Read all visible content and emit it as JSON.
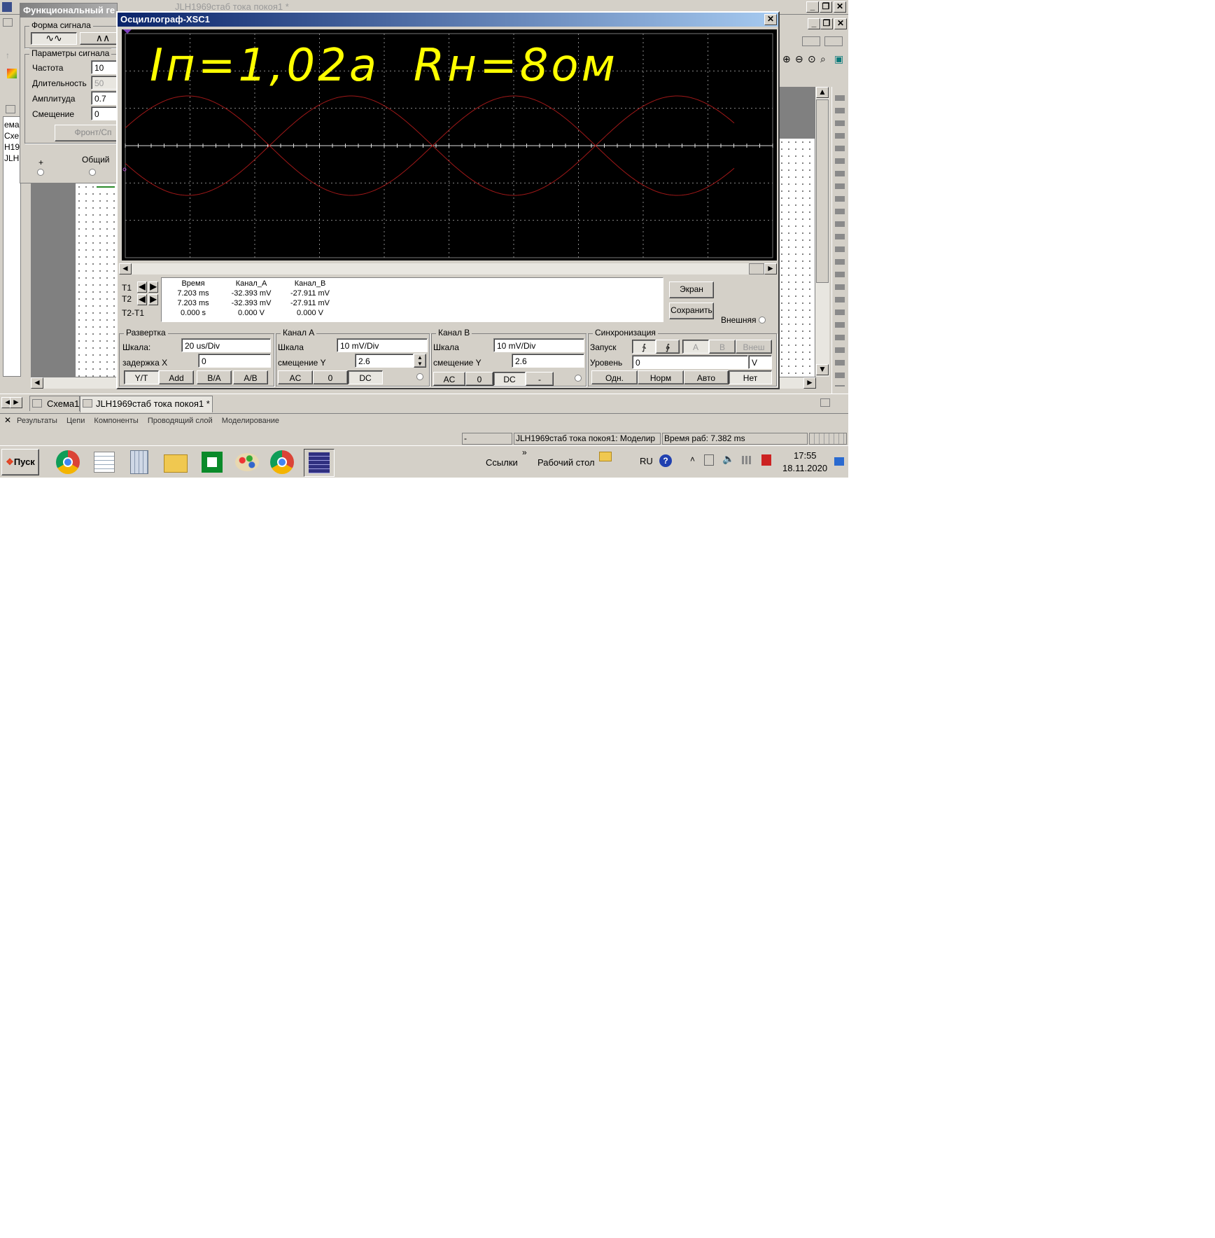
{
  "app": {
    "window_title": "JLH1969стаб тока покоя1 *",
    "tabs": [
      "Схема1",
      "JLH1969стаб тока покоя1 *"
    ],
    "results_tabs": [
      "Результаты",
      "Цепи",
      "Компоненты",
      "Проводящий слой",
      "Моделирование"
    ],
    "left_fragments": [
      "ема",
      "Схе",
      "Н19",
      "JLH"
    ],
    "status": {
      "left": "-",
      "middle": "JLH1969стаб тока покоя1: Моделир",
      "right": "Время раб: 7.382 ms"
    }
  },
  "fgen": {
    "title": "Функциональный ге",
    "waveform_group": "Форма сигнала",
    "params_group": "Параметры сигнала",
    "params": [
      {
        "label": "Частота",
        "value": "10",
        "disabled": false
      },
      {
        "label": "Длительность",
        "value": "50",
        "disabled": true
      },
      {
        "label": "Амплитуда",
        "value": "0.7",
        "disabled": false
      },
      {
        "label": "Смещение",
        "value": "0",
        "disabled": false
      }
    ],
    "front_button": "Фронт/Сп",
    "plus_label": "+",
    "common_label": "Общий"
  },
  "scope": {
    "title": "Осциллограф-XSC1",
    "annotation": "Iп=1,02а  Rн=8ом",
    "trace_color": "#a01818",
    "meas": {
      "headers": [
        "Время",
        "Канал_А",
        "Канал_В"
      ],
      "row_labels": [
        "T1",
        "T2",
        "T2-T1"
      ],
      "rows": [
        [
          "7.203 ms",
          "-32.393 mV",
          "-27.911 mV"
        ],
        [
          "7.203 ms",
          "-32.393 mV",
          "-27.911 mV"
        ],
        [
          "0.000 s",
          "0.000 V",
          "0.000 V"
        ]
      ]
    },
    "screen_button": "Экран",
    "save_button": "Сохранить",
    "external_label": "Внешняя",
    "timebase": {
      "title": "Развертка",
      "scale_label": "Шкала:",
      "scale": "20 us/Div",
      "delay_label": "задержка X",
      "delay": "0",
      "modes": [
        "Y/T",
        "Add",
        "B/A",
        "A/B"
      ]
    },
    "channel_a": {
      "title": "Канал А",
      "scale_label": "Шкала",
      "scale": "10 mV/Div",
      "offset_label": "смещение Y",
      "offset": "2.6",
      "coupling": [
        "AC",
        "0",
        "DC"
      ]
    },
    "channel_b": {
      "title": "Канал В",
      "scale_label": "Шкала",
      "scale": "10 mV/Div",
      "offset_label": "смещение Y",
      "offset": "2.6",
      "coupling": [
        "AC",
        "0",
        "DC",
        "-"
      ]
    },
    "trigger": {
      "title": "Синхронизация",
      "start_label": "Запуск",
      "edges": [
        "∱",
        "∲"
      ],
      "sources": [
        "A",
        "B",
        "Внеш"
      ],
      "level_label": "Уровень",
      "level": "0",
      "level_unit": "V",
      "modes": [
        "Одн.",
        "Норм",
        "Авто",
        "Нет"
      ]
    }
  },
  "taskbar": {
    "start": "Пуск",
    "links": "Ссылки",
    "desktop": "Рабочий стол",
    "lang": "RU",
    "time": "17:55",
    "date": "18.11.2020",
    "icons": [
      "chrome-icon",
      "notepad-icon",
      "calculator-icon",
      "folder-icon",
      "amd-icon",
      "paint-icon",
      "chrome-icon",
      "multisim-icon"
    ]
  }
}
